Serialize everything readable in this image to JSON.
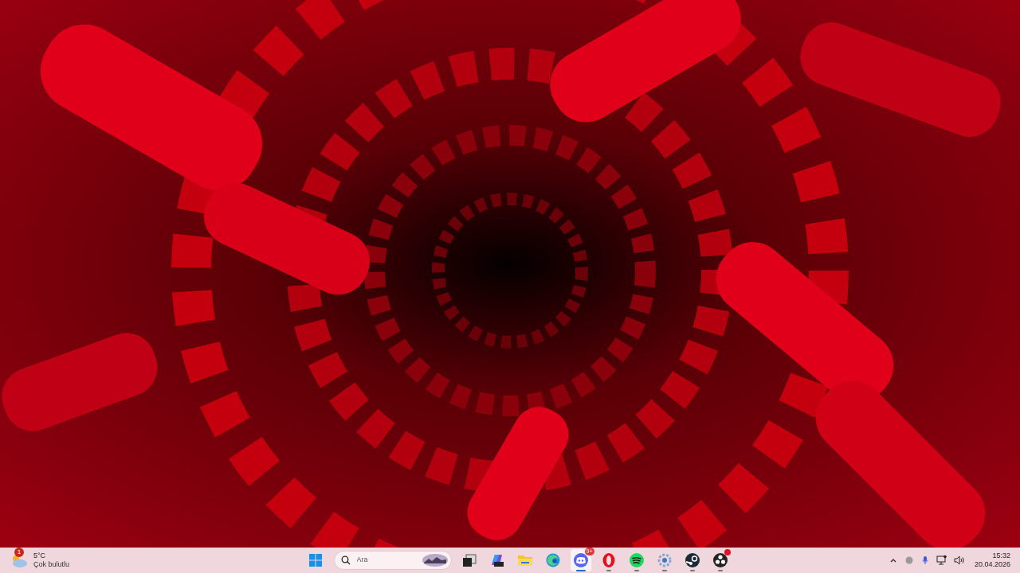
{
  "weather": {
    "temperature": "5°C",
    "condition": "Çok bulutlu",
    "badge": "1"
  },
  "start": {
    "selected": false
  },
  "search": {
    "placeholder": "Ara"
  },
  "taskbar_apps": [
    {
      "kind": "task-view",
      "running": false,
      "selected": false
    },
    {
      "kind": "copilot",
      "running": false,
      "selected": false
    },
    {
      "kind": "files",
      "running": false,
      "selected": false
    },
    {
      "kind": "edge",
      "running": false,
      "selected": false
    },
    {
      "kind": "discord",
      "running": true,
      "selected": true,
      "badge": "9+"
    },
    {
      "kind": "opera",
      "running": true,
      "selected": false
    },
    {
      "kind": "spotify",
      "running": true,
      "selected": false
    },
    {
      "kind": "gear",
      "running": true,
      "selected": false
    },
    {
      "kind": "steam",
      "running": true,
      "selected": false
    },
    {
      "kind": "obs",
      "running": true,
      "selected": false,
      "alert": true
    }
  ],
  "clock": {
    "time": "15:32",
    "date": "20.04.2026"
  }
}
